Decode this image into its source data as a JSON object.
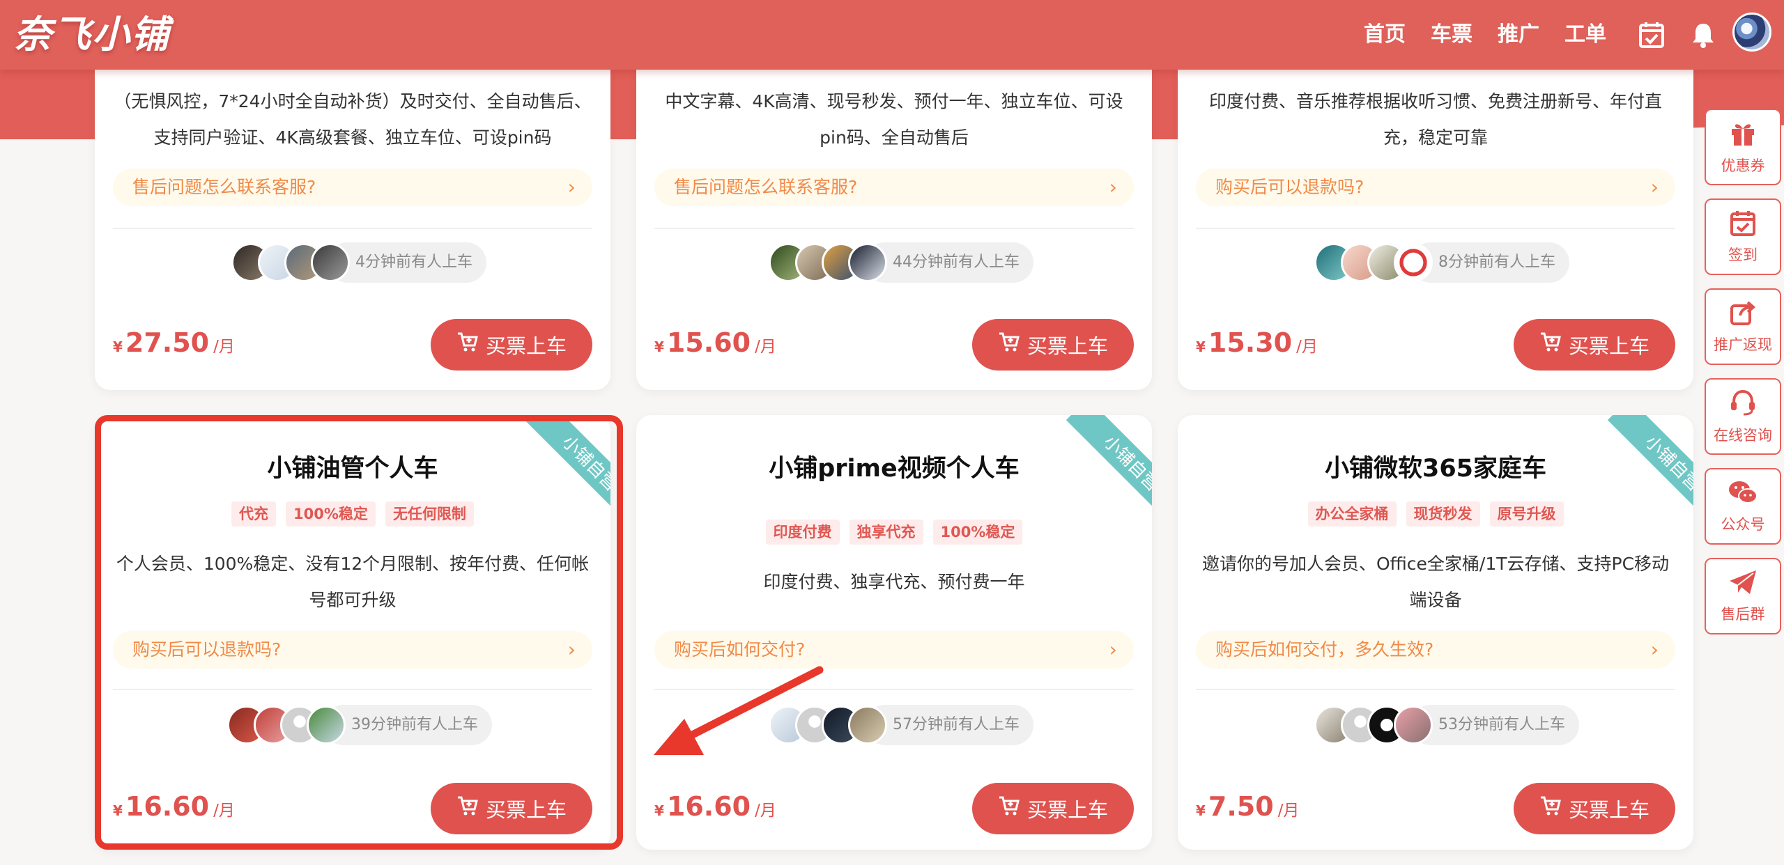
{
  "header": {
    "logo": "奈飞小铺",
    "nav": [
      "首页",
      "车票",
      "推广",
      "工单"
    ]
  },
  "buy_label": "买票上车",
  "ribbon_label": "小铺自营",
  "currency": "¥",
  "unit": "/月",
  "cards": [
    {
      "desc": "（无惧风控，7*24小时全自动补货）及时交付、全自动售后、支持同户验证、4K高级套餐、独立车位、可设pin码",
      "faq": "售后问题怎么联系客服?",
      "recent": "4分钟前有人上车",
      "price": "27.50"
    },
    {
      "desc": "中文字幕、4K高清、现号秒发、预付一年、独立车位、可设pin码、全自动售后",
      "faq": "售后问题怎么联系客服?",
      "recent": "44分钟前有人上车",
      "price": "15.60"
    },
    {
      "desc": "印度付费、音乐推荐根据收听习惯、免费注册新号、年付直充，稳定可靠",
      "faq": "购买后可以退款吗?",
      "recent": "8分钟前有人上车",
      "price": "15.30"
    },
    {
      "title": "小铺油管个人车",
      "tags": [
        "代充",
        "100%稳定",
        "无任何限制"
      ],
      "desc": "个人会员、100%稳定、没有12个月限制、按年付费、任何帐号都可升级",
      "faq": "购买后可以退款吗?",
      "recent": "39分钟前有人上车",
      "price": "16.60"
    },
    {
      "title": "小铺prime视频个人车",
      "tags": [
        "印度付费",
        "独享代充",
        "100%稳定"
      ],
      "desc": "印度付费、独享代充、预付费一年",
      "faq": "购买后如何交付?",
      "recent": "57分钟前有人上车",
      "price": "16.60"
    },
    {
      "title": "小铺微软365家庭车",
      "tags": [
        "办公全家桶",
        "现货秒发",
        "原号升级"
      ],
      "desc": "邀请你的号加人会员、Office全家桶/1T云存储、支持PC移动端设备",
      "faq": "购买后如何交付，多久生效?",
      "recent": "53分钟前有人上车",
      "price": "7.50"
    }
  ],
  "sidebar": [
    "优惠券",
    "签到",
    "推广返现",
    "在线咨询",
    "公众号",
    "售后群"
  ],
  "icons": {
    "calendar": "calendar-check-icon",
    "bell": "bell-icon",
    "cart": "cart-icon",
    "gift": "gift-icon",
    "share": "share-icon",
    "headset": "headset-icon",
    "wechat": "wechat-icon",
    "send": "paper-plane-icon"
  },
  "colors": {
    "brand": "#e0605a",
    "price": "#e0524e",
    "ribbon": "#6fc7c5",
    "faq_text": "#f08a48",
    "highlight": "#e8382b"
  }
}
